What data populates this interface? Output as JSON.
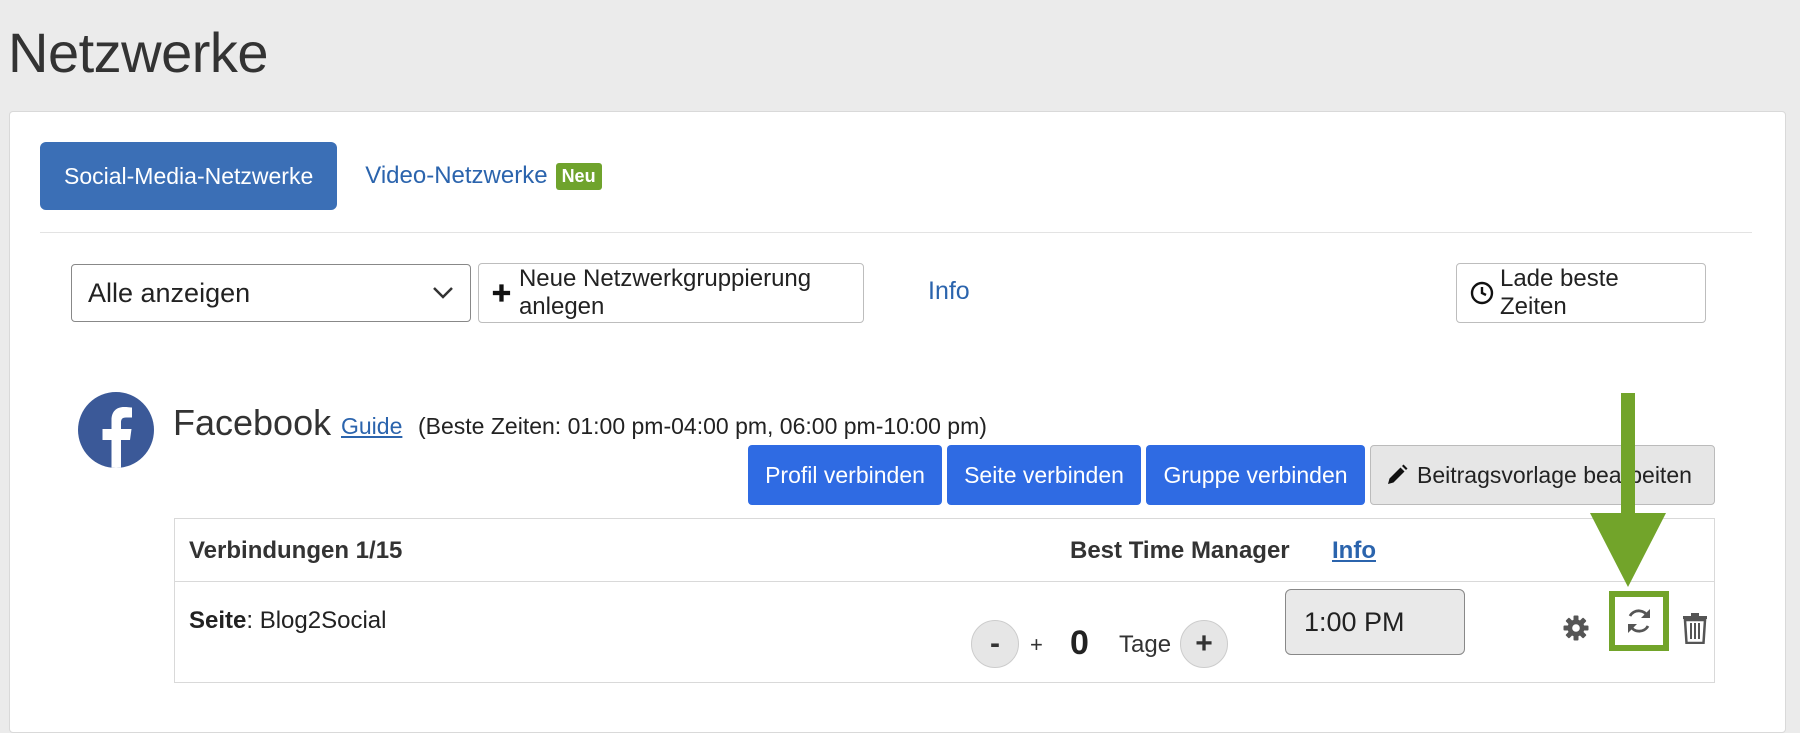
{
  "page": {
    "title": "Netzwerke"
  },
  "tabs": {
    "social_label": "Social-Media-Netzwerke",
    "video_label": "Video-Netzwerke",
    "video_badge": "Neu"
  },
  "toolbar": {
    "filter_selected": "Alle anzeigen",
    "new_group_label": "Neue Netzwerkgruppierung anlegen",
    "info_label": "Info",
    "best_times_label": "Lade beste Zeiten"
  },
  "network": {
    "name": "Facebook",
    "guide_label": "Guide",
    "best_times_text": "(Beste Zeiten: 01:00 pm-04:00 pm, 06:00 pm-10:00 pm)",
    "buttons": {
      "profile": "Profil verbinden",
      "page": "Seite verbinden",
      "group": "Gruppe verbinden",
      "template": "Beitragsvorlage bearbeiten"
    }
  },
  "connections": {
    "header_count": "Verbindungen 1/15",
    "btm_label": "Best Time Manager",
    "btm_info": "Info",
    "rows": [
      {
        "type": "Seite",
        "name": ": Blog2Social",
        "minus": "-",
        "plus_small": "+",
        "days": "0",
        "days_label": "Tage",
        "plus": "+",
        "time": "1:00 PM"
      }
    ]
  },
  "colors": {
    "primary": "#3b6fb6",
    "connect_blue": "#2f6be3",
    "badge_green": "#6fa32c",
    "highlight_green": "#72a42a",
    "facebook": "#3b5998"
  }
}
